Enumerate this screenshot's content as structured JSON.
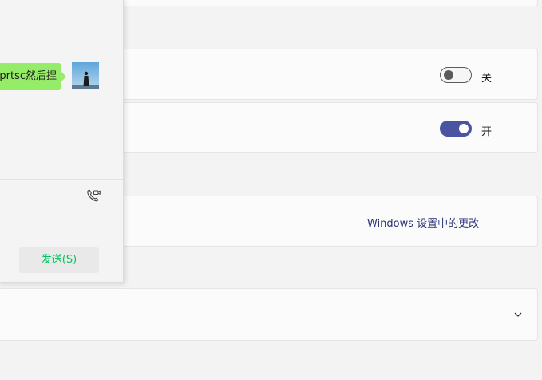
{
  "settings": {
    "toggle_off": {
      "state": "关",
      "on": false
    },
    "toggle_on": {
      "state": "开",
      "on": true
    },
    "link": {
      "label": "Windows 设置中的更改"
    }
  },
  "chat": {
    "message_text": "prtsc然后捏",
    "send_button": "发送(S)",
    "colors": {
      "bubble": "#95ec69",
      "send_text": "#07c160"
    }
  },
  "colors": {
    "accent": "#4a54a0",
    "link": "#2a3277"
  }
}
